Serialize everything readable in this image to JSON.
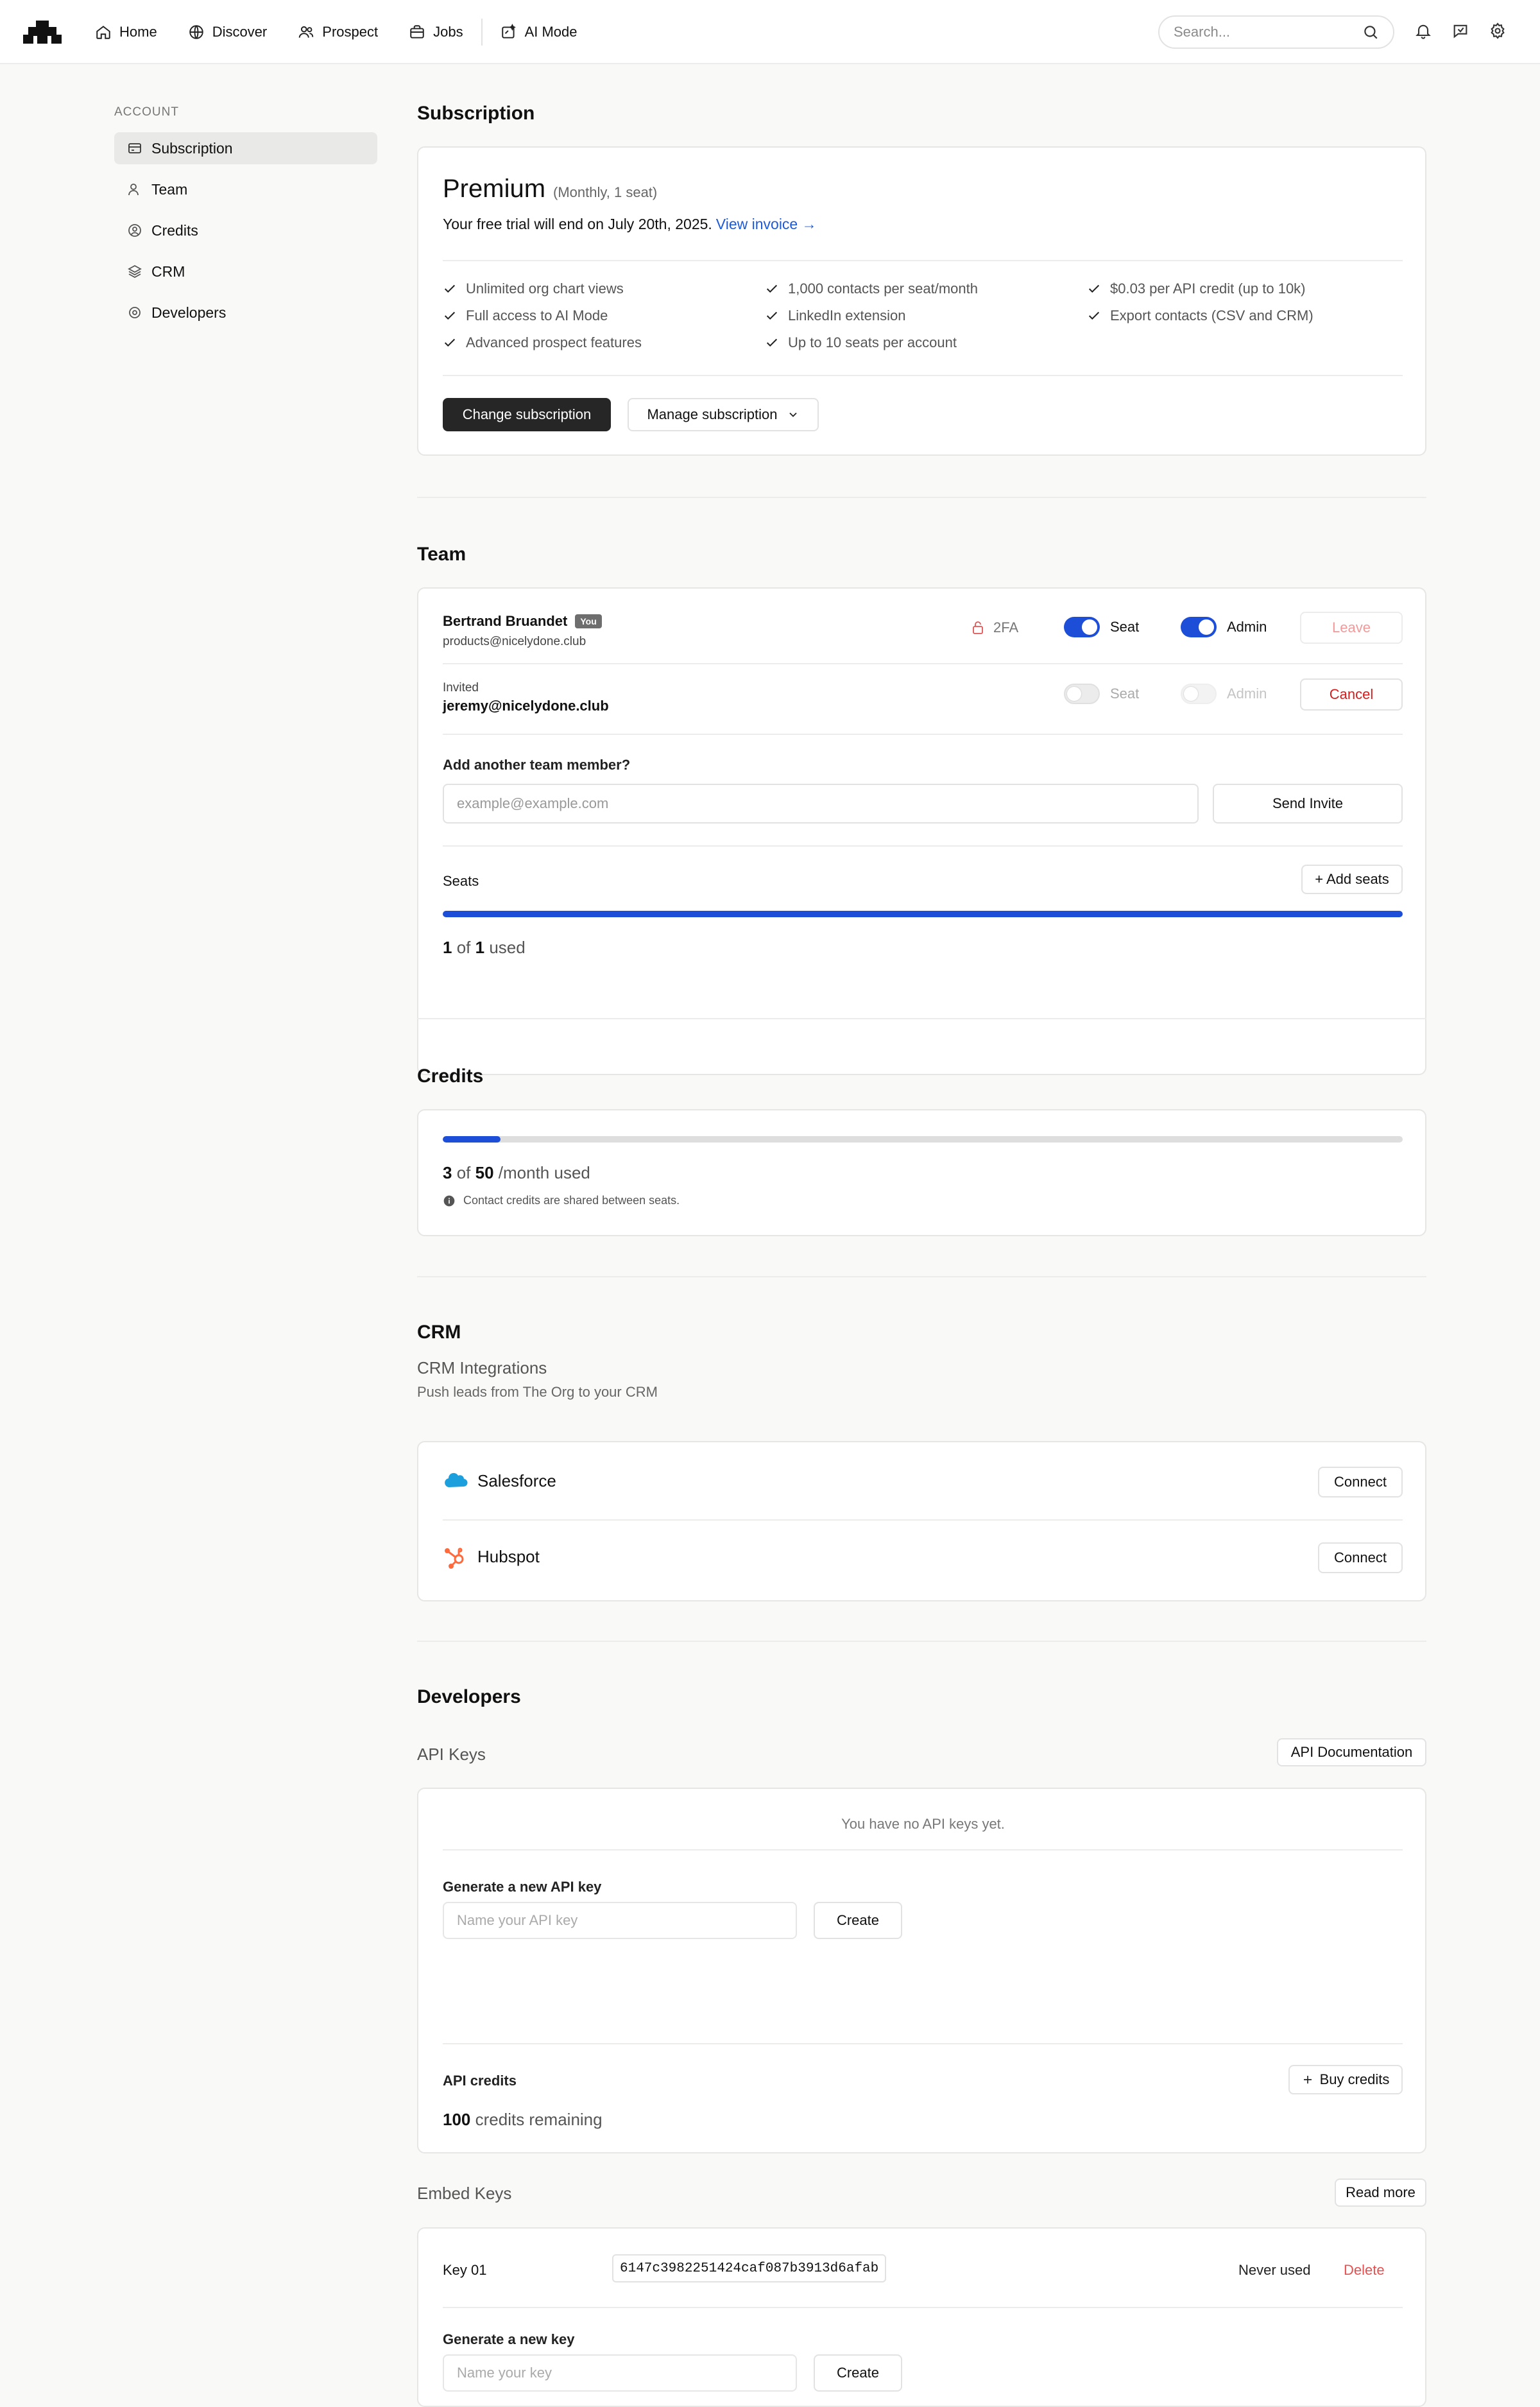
{
  "nav": {
    "items": [
      {
        "label": "Home",
        "icon": "home-icon"
      },
      {
        "label": "Discover",
        "icon": "globe-icon"
      },
      {
        "label": "Prospect",
        "icon": "users-icon"
      },
      {
        "label": "Jobs",
        "icon": "briefcase-icon"
      },
      {
        "label": "AI Mode",
        "icon": "sparkle-icon"
      }
    ],
    "search_placeholder": "Search..."
  },
  "sidebar": {
    "heading": "ACCOUNT",
    "items": [
      {
        "label": "Subscription",
        "icon": "card-icon",
        "active": true
      },
      {
        "label": "Team",
        "icon": "user-icon",
        "active": false
      },
      {
        "label": "Credits",
        "icon": "coin-icon",
        "active": false
      },
      {
        "label": "CRM",
        "icon": "layers-icon",
        "active": false
      },
      {
        "label": "Developers",
        "icon": "cog-icon",
        "active": false
      }
    ]
  },
  "subscription": {
    "title": "Subscription",
    "plan": "Premium",
    "plan_meta": "(Monthly, 1 seat)",
    "trial_text": "Your free trial will end on July 20th, 2025.",
    "invoice_link": "View invoice →",
    "features": [
      "Unlimited org chart views",
      "1,000 contacts per seat/month",
      "$0.03 per API credit (up to 10k)",
      "Full access to AI Mode",
      "LinkedIn extension",
      "Export contacts (CSV and CRM)",
      "Advanced prospect features",
      "Up to 10 seats per account"
    ],
    "change_button": "Change subscription",
    "manage_button": "Manage subscription"
  },
  "team": {
    "title": "Team",
    "member": {
      "name": "Bertrand Bruandet",
      "badge": "You",
      "email": "products@nicelydone.club",
      "twofa": "2FA",
      "seat_label": "Seat",
      "admin_label": "Admin",
      "leave_button": "Leave"
    },
    "invite": {
      "status": "Invited",
      "email": "jeremy@nicelydone.club",
      "seat_label": "Seat",
      "admin_label": "Admin",
      "cancel_button": "Cancel"
    },
    "add_label": "Add another team member?",
    "email_placeholder": "example@example.com",
    "send_button": "Send Invite",
    "seats_label": "Seats",
    "add_seats_button": "+ Add seats",
    "seats_used": "1",
    "seats_total": "1",
    "used_word": "used",
    "of_word": "of"
  },
  "credits": {
    "title": "Credits",
    "used": "3",
    "total": "50",
    "unit": "/month used",
    "of_word": "of",
    "fraction": 0.06,
    "note": "Contact credits are shared between seats."
  },
  "crm": {
    "title": "CRM",
    "subtitle": "CRM Integrations",
    "description": "Push leads from The Org to your CRM",
    "integrations": [
      {
        "name": "Salesforce",
        "button": "Connect"
      },
      {
        "name": "Hubspot",
        "button": "Connect"
      }
    ]
  },
  "developers": {
    "title": "Developers",
    "api_keys_label": "API Keys",
    "api_doc_button": "API Documentation",
    "no_keys_text": "You have no API keys yet.",
    "generate_api_label": "Generate a new API key",
    "api_key_placeholder": "Name your API key",
    "create_button": "Create",
    "api_credits_label": "API credits",
    "buy_credits_button": "Buy credits",
    "credits_remaining_value": "100",
    "credits_remaining_text": "credits remaining",
    "embed_keys_label": "Embed Keys",
    "read_more_button": "Read more",
    "embed_key": {
      "name": "Key 01",
      "value": "6147c3982251424caf087b3913d6afab",
      "usage": "Never used",
      "delete": "Delete"
    },
    "generate_key_label": "Generate a new key",
    "key_placeholder": "Name your key"
  },
  "colors": {
    "accent": "#1d4ed8",
    "link": "#1d5bd6",
    "danger": "#d11f1f",
    "primary_button": "#262626"
  }
}
